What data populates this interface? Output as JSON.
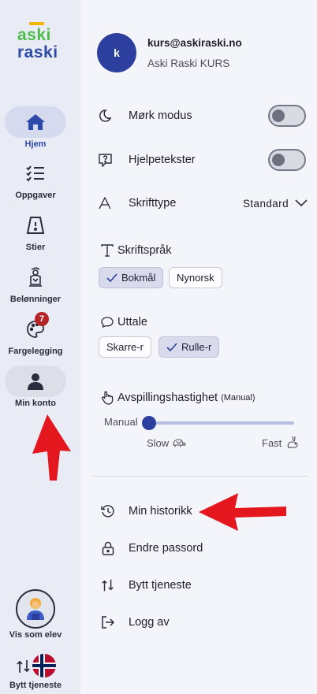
{
  "logo": {
    "line1": "aski",
    "line2": "raski"
  },
  "nav": {
    "items": [
      {
        "label": "Hjem",
        "icon": "home-icon"
      },
      {
        "label": "Oppgaver",
        "icon": "checklist-icon"
      },
      {
        "label": "Stier",
        "icon": "path-sign-icon"
      },
      {
        "label": "Belønninger",
        "icon": "trophy-icon"
      },
      {
        "label": "Fargelegging",
        "icon": "palette-icon",
        "badge": "7"
      },
      {
        "label": "Min konto",
        "icon": "user-icon"
      }
    ],
    "bottom": [
      {
        "label": "Vis som elev",
        "icon": "student-avatar-icon"
      },
      {
        "label": "Bytt tjeneste",
        "icon": "switch-service-icon"
      }
    ]
  },
  "profile": {
    "initial": "k",
    "email": "kurs@askiraski.no",
    "name": "Aski Raski KURS"
  },
  "settings": {
    "dark_mode": {
      "label": "Mørk modus",
      "on": false
    },
    "help_texts": {
      "label": "Hjelpetekster",
      "on": false
    },
    "font": {
      "label": "Skrifttype",
      "value": "Standard"
    },
    "written_language": {
      "label": "Skriftspråk",
      "options": [
        "Bokmål",
        "Nynorsk"
      ],
      "selected": "Bokmål"
    },
    "pronunciation": {
      "label": "Uttale",
      "options": [
        "Skarre-r",
        "Rulle-r"
      ],
      "selected": "Rulle-r"
    },
    "playback_speed": {
      "label": "Avspillingshastighet",
      "mode": "(Manual)",
      "slider_label": "Manual",
      "min_label": "Slow",
      "max_label": "Fast",
      "value": 0
    }
  },
  "menu": [
    {
      "label": "Min historikk",
      "icon": "history-icon"
    },
    {
      "label": "Endre passord",
      "icon": "lock-icon"
    },
    {
      "label": "Bytt tjeneste",
      "icon": "switch-service-icon"
    },
    {
      "label": "Logg av",
      "icon": "logout-icon"
    }
  ],
  "colors": {
    "brand_blue": "#2d3f9e",
    "brand_green": "#4dbd4a",
    "accent_yellow": "#f5b400",
    "annotation_red": "#e3171d",
    "badge_red": "#b52428"
  }
}
